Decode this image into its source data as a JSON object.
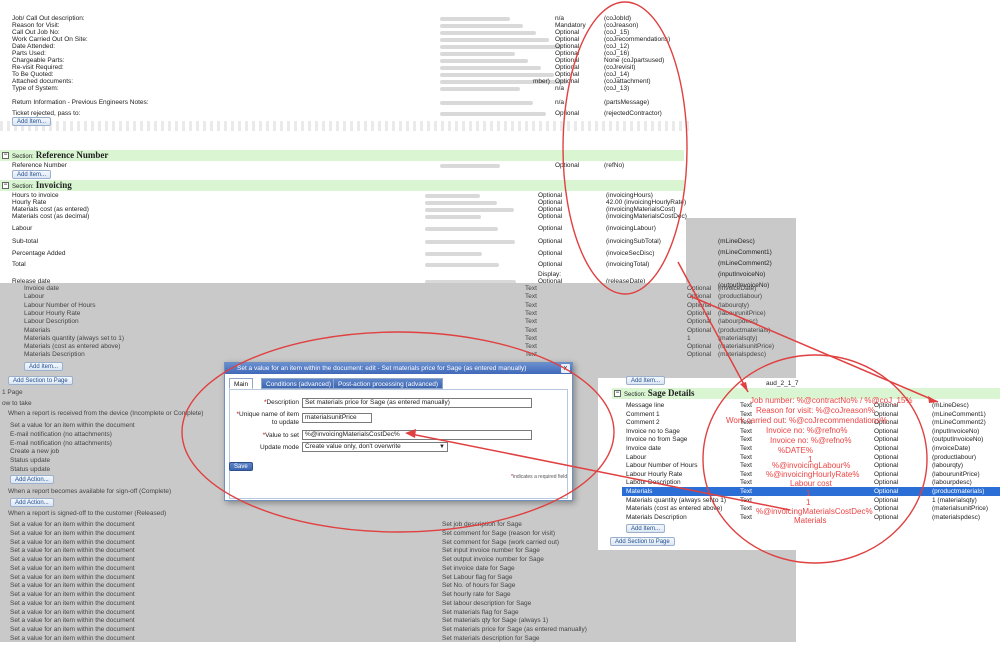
{
  "top_table": {
    "rows": [
      {
        "label": "Job/ Call Out description:",
        "req": "n/a",
        "code": "(coJobId)"
      },
      {
        "label": "Reason for Visit:",
        "req": "Mandatory",
        "code": "(coJreason)"
      },
      {
        "label": "Call Out Job No:",
        "req": "Optional",
        "code": "(coJ_15)"
      },
      {
        "label": "Work Carried Out On Site:",
        "req": "Optional",
        "code": "(coJrecommendations)"
      },
      {
        "label": "Date Attended:",
        "req": "Optional",
        "code": "(coJ_12)"
      },
      {
        "label": "Parts Used:",
        "req": "Optional",
        "code": "(coJ_16)"
      },
      {
        "label": "Chargeable Parts:",
        "req": "Optional",
        "code": "None (coJpartsused)"
      },
      {
        "label": "Re-visit Required:",
        "req": "Optional",
        "code": "(coJrevisit)"
      },
      {
        "label": "To Be Quoted:",
        "req": "Optional",
        "code": "(coJ_14)"
      },
      {
        "label": "Attached documents:",
        "req": "Optional",
        "code": "(coJattachment)"
      },
      {
        "label": "Type of System:",
        "req": "n/a",
        "code": "(coJ_13)"
      },
      {
        "label": "Return Information - Previous Engineers Notes:",
        "req": "n/a",
        "code": "(partsMessage)"
      },
      {
        "label": "Ticket rejected, pass to:",
        "req": "Optional",
        "code": "(rejectedContractor)"
      }
    ],
    "attached_fragment": "mber)",
    "add_item": "Add Item..."
  },
  "reference_section": {
    "prefix": "Section:",
    "title": "Reference Number",
    "rows": [
      {
        "label": "Reference Number",
        "req": "Optional",
        "code": "(refNo)"
      }
    ],
    "add_item": "Add Item..."
  },
  "invoicing_section": {
    "prefix": "Section:",
    "title": "Invoicing",
    "rows": [
      {
        "label": "Hours to invoice",
        "req": "Optional",
        "code": "(invoicingHours)"
      },
      {
        "label": "Hourly Rate",
        "req": "Optional",
        "code": "42.00 (invoicingHourlyRate)"
      },
      {
        "label": "Materials cost (as entered)",
        "req": "Optional",
        "code": "(invoicingMaterialsCost)"
      },
      {
        "label": "Materials cost (as decimal)",
        "req": "Optional",
        "code": "(invoicingMaterialsCostDec)"
      },
      {
        "label": "Labour",
        "req": "Optional",
        "code": "(invoicingLabour)"
      },
      {
        "label": "Sub-total",
        "req": "Optional",
        "code": "(invoicingSubTotal)"
      },
      {
        "label": "Percentage Added",
        "req": "Optional",
        "code": "(invoiceSecDisc)"
      },
      {
        "label": "Total",
        "req": "Optional",
        "code": "(invoicingTotal)"
      },
      {
        "label": "Release date",
        "req": "Optional",
        "req2": "Display:",
        "code": "(releaseDate)"
      }
    ],
    "right_codes": [
      "(mLineDesc)",
      "(mLineComment1)",
      "(mLineComment2)",
      "(inputInvoiceNo)",
      "(outputInvoiceNo)"
    ]
  },
  "background_items": {
    "rows": [
      {
        "label": "Invoice date",
        "type": "Text",
        "req": "Optional",
        "code": "(invoiceDate)"
      },
      {
        "label": "Labour",
        "type": "Text",
        "req": "Optional",
        "code": "(productlabour)"
      },
      {
        "label": "Labour Number of Hours",
        "type": "Text",
        "req": "Optional",
        "code": "(labourqty)"
      },
      {
        "label": "Labour Hourly Rate",
        "type": "Text",
        "req": "Optional",
        "code": "(labourunitPrice)"
      },
      {
        "label": "Labour Description",
        "type": "Text",
        "req": "Optional",
        "code": "(labourpdesc)"
      },
      {
        "label": "Materials",
        "type": "Text",
        "req": "Optional",
        "code": "(productmaterials)"
      },
      {
        "label": "Materials quantity (always set to 1)",
        "type": "Text",
        "req": "1",
        "code": "(materialsqty)"
      },
      {
        "label": "Materials (cost as entered above)",
        "type": "Text",
        "req": "Optional",
        "code": "(materialsunitPrice)"
      },
      {
        "label": "Materials Description",
        "type": "Text",
        "req": "Optional",
        "code": "(materialspdesc)"
      }
    ],
    "add_item": "Add Item...",
    "add_section": "Add Section to Page",
    "page_label": "1 Page",
    "how_to_take": "ow to take",
    "received_heading": "When a report is received from the device (Incomplete or Complete)",
    "received_actions": [
      "Set a value for an item within the document",
      "E-mail notification (no attachments)",
      "E-mail notification (no attachments)",
      "Create a new job",
      "Status update",
      "Status update"
    ],
    "add_action": "Add Action...",
    "signoff_heading": "When a report becomes available for sign-off (Complete)",
    "released_heading": "When a report is signed-off to the customer (Released)",
    "released_actions": [
      {
        "action": "Set a value for an item within the document",
        "desc": "Set job description for Sage"
      },
      {
        "action": "Set a value for an item within the document",
        "desc": "Set comment for Sage (reason for visit)"
      },
      {
        "action": "Set a value for an item within the document",
        "desc": "Set comment for Sage (work carried out)"
      },
      {
        "action": "Set a value for an item within the document",
        "desc": "Set input invoice number for Sage"
      },
      {
        "action": "Set a value for an item within the document",
        "desc": "Set output invoice number for Sage"
      },
      {
        "action": "Set a value for an item within the document",
        "desc": "Set invoice date for Sage"
      },
      {
        "action": "Set a value for an item within the document",
        "desc": "Set Labour flag for Sage"
      },
      {
        "action": "Set a value for an item within the document",
        "desc": "Set No. of hours for Sage"
      },
      {
        "action": "Set a value for an item within the document",
        "desc": "Set hourly rate for Sage"
      },
      {
        "action": "Set a value for an item within the document",
        "desc": "Set labour description for Sage"
      },
      {
        "action": "Set a value for an item within the document",
        "desc": "Set materials flag for Sage"
      },
      {
        "action": "Set a value for an item within the document",
        "desc": "Set materials qty for Sage (always 1)"
      },
      {
        "action": "Set a value for an item within the document",
        "desc": "Set materials price for Sage (as entered manually)"
      },
      {
        "action": "Set a value for an item within the document",
        "desc": "Set materials description for Sage"
      }
    ]
  },
  "dialog": {
    "title": "Set a value for an item within the document: edit - Set materials price for Sage (as entered manually)",
    "close": "x",
    "tabs": [
      "Main",
      "Conditions (advanced)",
      "Post-action processing (advanced)"
    ],
    "description_label": "Description",
    "description_value": "Set materials price for Sage (as entered manually)",
    "unique_label_1": "Unique name of item",
    "unique_label_2": "to update",
    "unique_value": "materialsunitPrice",
    "value_label": "Value to set",
    "value_value": "%@invoicingMaterialsCostDec%",
    "update_label": "Update mode",
    "update_value": "Create value only, don't overwrite",
    "save": "Save",
    "required_note": "indicates a required field",
    "asterisk": "*"
  },
  "sage_section": {
    "top_add_item": "Add Item...",
    "header_code": "aud_2_1_7",
    "prefix": "Section:",
    "title": "Sage Details",
    "rows": [
      {
        "label": "Message line",
        "type": "Text",
        "req": "Optional",
        "code": "(mLineDesc)"
      },
      {
        "label": "Comment 1",
        "type": "Text",
        "req": "Optional",
        "code": "(mLineComment1)"
      },
      {
        "label": "Comment 2",
        "type": "Text",
        "req": "Optional",
        "code": "(mLineComment2)"
      },
      {
        "label": "Invoice no to Sage",
        "type": "Text",
        "req": "Optional",
        "code": "(inputInvoiceNo)"
      },
      {
        "label": "Invoice no from Sage",
        "type": "Text",
        "req": "Optional",
        "code": "(outputInvoiceNo)"
      },
      {
        "label": "Invoice date",
        "type": "Text",
        "req": "Optional",
        "code": "(invoiceDate)"
      },
      {
        "label": "Labour",
        "type": "Text",
        "req": "Optional",
        "code": "(productlabour)"
      },
      {
        "label": "Labour Number of Hours",
        "type": "Text",
        "req": "Optional",
        "code": "(labourqty)"
      },
      {
        "label": "Labour Hourly Rate",
        "type": "Text",
        "req": "Optional",
        "code": "(labourunitPrice)"
      },
      {
        "label": "Labour Description",
        "type": "Text",
        "req": "Optional",
        "code": "(labourpdesc)"
      },
      {
        "label": "Materials",
        "type": "Text",
        "req": "Optional",
        "code": "(productmaterials)"
      },
      {
        "label": "Materials quantity (always set to 1)",
        "type": "Text",
        "req": "Optional",
        "code": "1 (materialsqty)"
      },
      {
        "label": "Materials (cost as entered above)",
        "type": "Text",
        "req": "Optional",
        "code": "(materialsunitPrice)"
      },
      {
        "label": "Materials Description",
        "type": "Text",
        "req": "Optional",
        "code": "(materialspdesc)"
      }
    ],
    "add_item": "Add Item...",
    "add_section": "Add Section to Page"
  },
  "annotations": [
    "Job number: %@contractNo% / %@coJ_15%",
    "Reason for visit: %@coJreason%",
    "Work carried out: %@coJrecommendations%",
    "Invoice no: %@refno%",
    "Invoice no: %@refno%",
    "%DATE%",
    "1",
    "%@invoicingLabour%",
    "%@invoicingHourlyRate%",
    "Labour cost",
    "1",
    "1",
    "%@invoicingMaterialsCostDec%",
    "Materials"
  ],
  "colors": {
    "section_bg": "#d9f5d2",
    "selected_row": "#2b6fd6",
    "annotation_red": "#e44444",
    "dialog_title": "#4a73c0"
  }
}
